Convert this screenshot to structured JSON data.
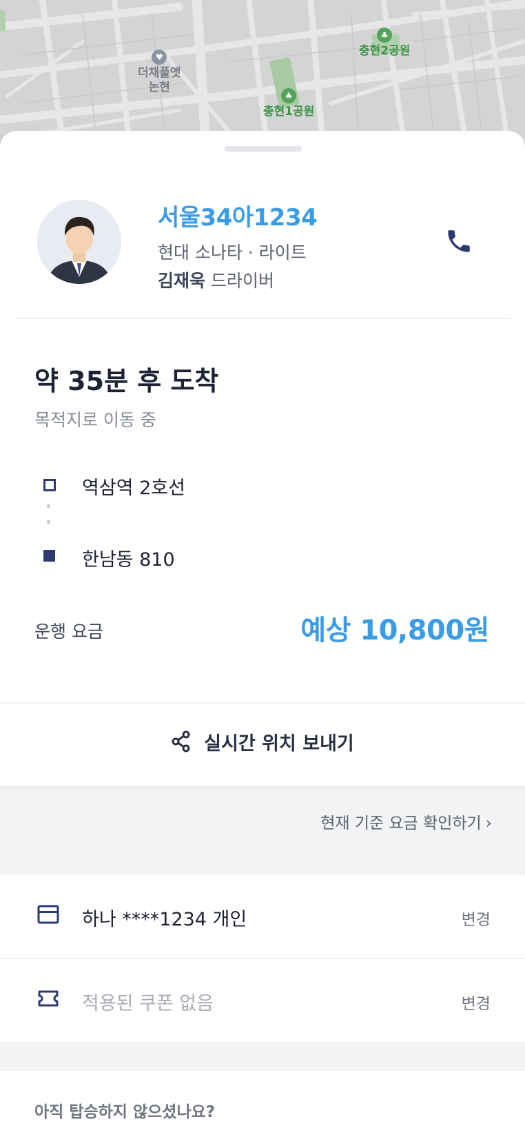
{
  "map": {
    "poi_1": "더채플앳\n논현",
    "poi_2": "충현2공원",
    "poi_3": "충현1공원"
  },
  "driver_card": {
    "plate_number": "서울34아1234",
    "car_info": "현대 소나타 · 라이트",
    "driver_name": "김재욱",
    "driver_suffix": " 드라이버",
    "call_icon": "phone-icon"
  },
  "trip": {
    "eta": "약 35분 후 도착",
    "status": "목적지로 이동 중",
    "origin": "역삼역 2호선",
    "destination": "한남동 810"
  },
  "fare": {
    "label": "운행 요금",
    "value": "예상 10,800원"
  },
  "share": {
    "label": "실시간 위치 보내기",
    "icon": "share-icon"
  },
  "fare_check": {
    "label": "현재 기준 요금 확인하기"
  },
  "payment": {
    "card_label": "하나 ****1234 개인",
    "card_change": "변경",
    "coupon_label": "적용된 쿠폰 없음",
    "coupon_change": "변경"
  },
  "footer": {
    "not_boarded": "아직 탑승하지 않으셨나요?"
  },
  "colors": {
    "accent_blue": "#3a9be8",
    "navy": "#2c3a74",
    "text_dark": "#1e2233",
    "text_muted": "#868b97"
  }
}
